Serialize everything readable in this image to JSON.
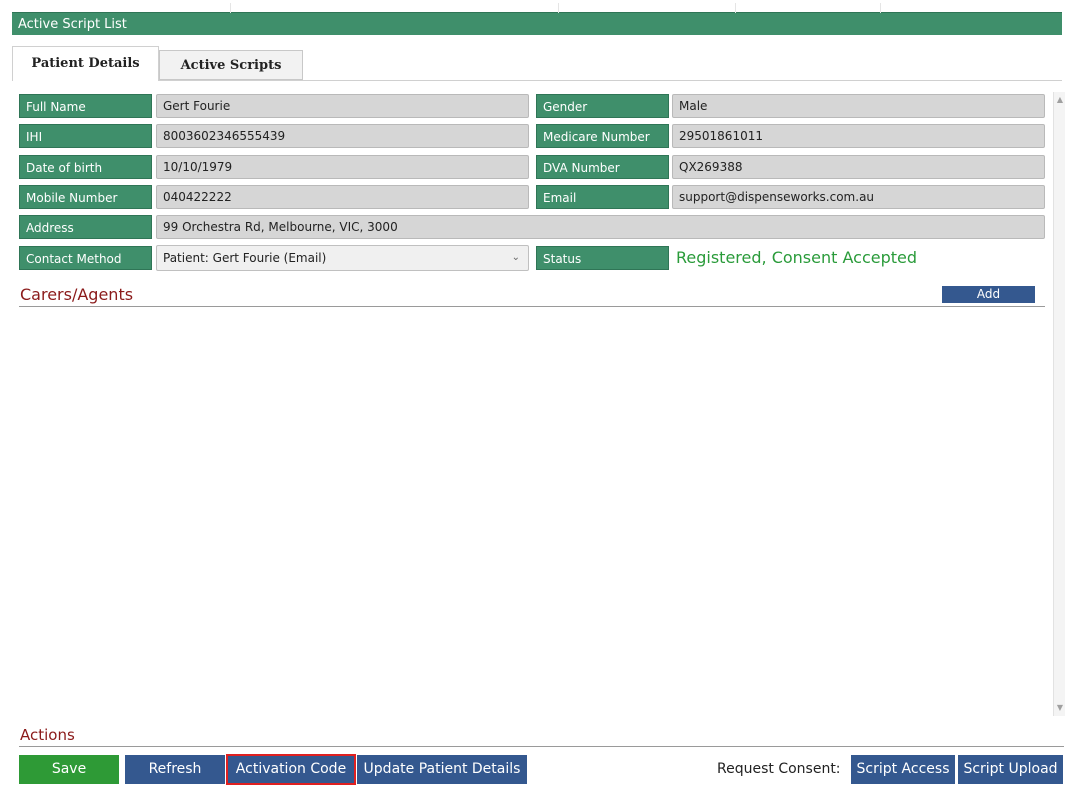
{
  "window": {
    "title": "Active Script List"
  },
  "tabs": [
    {
      "label": "Patient Details",
      "active": true
    },
    {
      "label": "Active Scripts",
      "active": false
    }
  ],
  "patient": {
    "full_name": {
      "label": "Full Name",
      "value": "Gert Fourie"
    },
    "gender": {
      "label": "Gender",
      "value": "Male"
    },
    "ihi": {
      "label": "IHI",
      "value": "8003602346555439"
    },
    "medicare": {
      "label": "Medicare Number",
      "value": "29501861011"
    },
    "dob": {
      "label": "Date of birth",
      "value": "10/10/1979"
    },
    "dva": {
      "label": "DVA Number",
      "value": "QX269388"
    },
    "mobile": {
      "label": "Mobile Number",
      "value": "040422222"
    },
    "email": {
      "label": "Email",
      "value": "support@dispenseworks.com.au"
    },
    "address": {
      "label": "Address",
      "value": "99 Orchestra Rd, Melbourne, VIC, 3000"
    },
    "contact_method": {
      "label": "Contact Method",
      "value": "Patient: Gert Fourie (Email)"
    },
    "status": {
      "label": "Status",
      "value": "Registered,  Consent Accepted"
    }
  },
  "carers": {
    "title": "Carers/Agents",
    "add_label": "Add"
  },
  "actions": {
    "title": "Actions",
    "save": "Save",
    "refresh": "Refresh",
    "activation_code": "Activation Code",
    "update_patient": "Update Patient Details",
    "request_consent_label": "Request Consent:",
    "script_access": "Script Access",
    "script_upload": "Script Upload"
  },
  "colors": {
    "label_green": "#3f8f6b",
    "button_blue": "#34588f",
    "save_green": "#2e9a36",
    "status_green": "#2a9b3a",
    "section_red": "#8b1a1a",
    "highlight_red": "#e02020"
  },
  "icons": {
    "dropdown": "chevron-down-icon",
    "scroll_up": "scroll-up-arrow-icon",
    "scroll_down": "scroll-down-arrow-icon"
  }
}
